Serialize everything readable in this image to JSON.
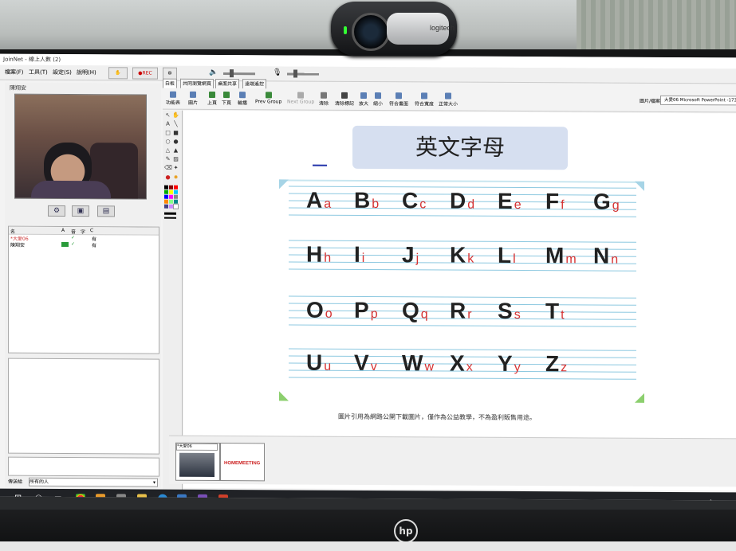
{
  "app": {
    "window_title": "JoinNet - 線上人數 (2)",
    "menu": [
      "檔案(F)",
      "工具(T)",
      "設定(S)",
      "說明(H)"
    ],
    "rec_label": "●REC"
  },
  "left_panel": {
    "video_owner": "陳翔安",
    "user_list": {
      "headers": [
        "名",
        "A",
        "音",
        "字",
        "C"
      ],
      "rows": [
        {
          "name": "*大愛06",
          "status": "有"
        },
        {
          "name": "陳翔安",
          "status": "有"
        }
      ]
    },
    "send_to_label": "傳送給",
    "send_to_value": "所有的人"
  },
  "whiteboard": {
    "tabs": [
      "白板",
      "共同瀏覽網頁",
      "桌面共享",
      "遠端遙控"
    ],
    "toolbar": [
      {
        "label": "功能表"
      },
      {
        "label": "圖片"
      },
      {
        "label": "上頁"
      },
      {
        "label": "下頁"
      },
      {
        "label": "輪播"
      },
      {
        "label": "Prev Group"
      },
      {
        "label": "Next Group"
      },
      {
        "label": "清除"
      },
      {
        "label": "清除標記"
      },
      {
        "label": "放大"
      },
      {
        "label": "縮小"
      },
      {
        "label": "符合畫面"
      },
      {
        "label": "符合寬度"
      },
      {
        "label": "正常大小"
      }
    ],
    "file_label": "圖片/檔案",
    "file_value": "大愛06 Microsoft PowerPoint -17337612969_189"
  },
  "slide": {
    "title": "英文字母",
    "rows": [
      [
        [
          "A",
          "a"
        ],
        [
          "B",
          "b"
        ],
        [
          "C",
          "c"
        ],
        [
          "D",
          "d"
        ],
        [
          "E",
          "e"
        ],
        [
          "F",
          "f"
        ],
        [
          "G",
          "g"
        ]
      ],
      [
        [
          "H",
          "h"
        ],
        [
          "I",
          "i"
        ],
        [
          "J",
          "j"
        ],
        [
          "K",
          "k"
        ],
        [
          "L",
          "l"
        ],
        [
          "M",
          "m"
        ],
        [
          "N",
          "n"
        ]
      ],
      [
        [
          "O",
          "o"
        ],
        [
          "P",
          "p"
        ],
        [
          "Q",
          "q"
        ],
        [
          "R",
          "r"
        ],
        [
          "S",
          "s"
        ],
        [
          "T",
          "t"
        ]
      ],
      [
        [
          "U",
          "u"
        ],
        [
          "V",
          "v"
        ],
        [
          "W",
          "w"
        ],
        [
          "X",
          "x"
        ],
        [
          "Y",
          "y"
        ],
        [
          "Z",
          "z"
        ]
      ]
    ],
    "caption": "圖片引用為網路公開下載圖片，僅作為公益教學，不為盈利販售用途。",
    "colors": {
      "uppercase": "#222222",
      "lowercase": "#d63232",
      "title_box": "#d6dff0"
    }
  },
  "thumbnails": {
    "select_value": "*大愛06",
    "items": [
      "webcam-thumbnail",
      "HOMEMEETING"
    ]
  },
  "hardware": {
    "webcam_brand": "logitech",
    "monitor_brand": "hp"
  }
}
